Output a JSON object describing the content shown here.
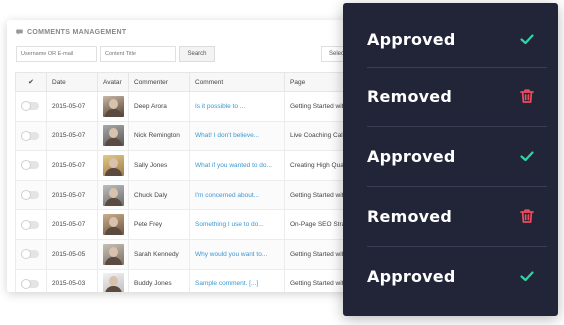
{
  "header": {
    "title": "COMMENTS MANAGEMENT"
  },
  "filters": {
    "user_placeholder": "Username OR E-mail",
    "content_placeholder": "Content Title",
    "search_label": "Search",
    "select_label": "Select"
  },
  "table": {
    "columns": [
      "✔",
      "Date",
      "Avatar",
      "Commenter",
      "Comment",
      "Page"
    ],
    "rows": [
      {
        "date": "2015-05-07",
        "commenter": "Deep Arora",
        "comment": "Is it possible to ...",
        "page": "Getting Started with"
      },
      {
        "date": "2015-05-07",
        "commenter": "Nick Remington",
        "comment": "What! I don't believe...",
        "page": "Live Coaching Call"
      },
      {
        "date": "2015-05-07",
        "commenter": "Sally Jones",
        "comment": "What if you wanted to do...",
        "page": "Creating High Qua"
      },
      {
        "date": "2015-05-07",
        "commenter": "Chuck Daly",
        "comment": "I'm concerned about...",
        "page": "Getting Started with"
      },
      {
        "date": "2015-05-07",
        "commenter": "Pete Frey",
        "comment": "Something I use to do...",
        "page": "On-Page SEO Stra"
      },
      {
        "date": "2015-05-05",
        "commenter": "Sarah Kennedy",
        "comment": "Why would you want to...",
        "page": "Getting Started with"
      },
      {
        "date": "2015-05-03",
        "commenter": "Buddy Jones",
        "comment": "Sample comment. [...]",
        "page": "Getting Started with"
      }
    ]
  },
  "status_panel": {
    "items": [
      {
        "label": "Approved",
        "icon": "checkmark-icon"
      },
      {
        "label": "Removed",
        "icon": "trash-icon"
      },
      {
        "label": "Approved",
        "icon": "checkmark-icon"
      },
      {
        "label": "Removed",
        "icon": "trash-icon"
      },
      {
        "label": "Approved",
        "icon": "checkmark-icon"
      }
    ]
  },
  "colors": {
    "panel_bg": "#222538",
    "approved_accent": "#2fd6a5",
    "removed_accent": "#ee4b5e",
    "link_blue": "#3a97d4"
  }
}
